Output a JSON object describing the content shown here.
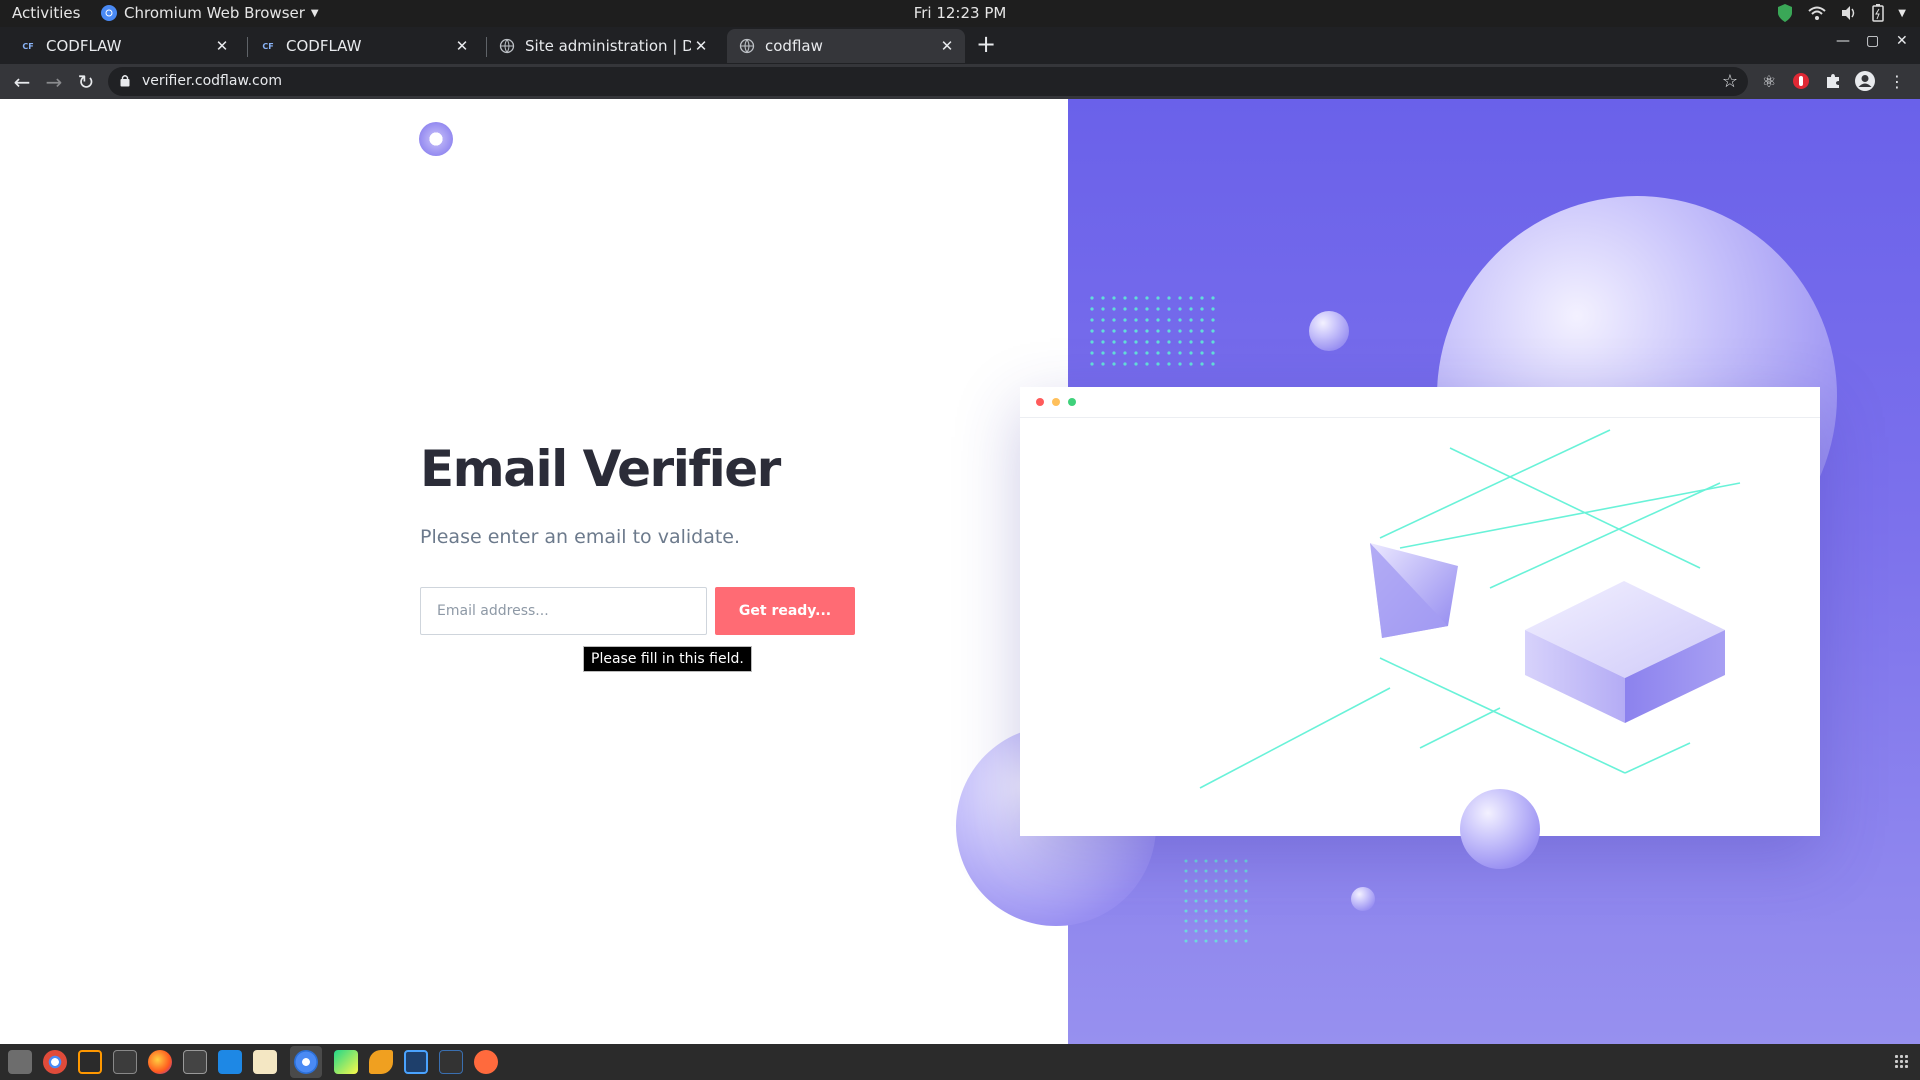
{
  "system": {
    "activities": "Activities",
    "app_name": "Chromium Web Browser",
    "clock": "Fri 12:23 PM"
  },
  "tabs": [
    {
      "title": "CODFLAW",
      "favicon": "CF"
    },
    {
      "title": "CODFLAW",
      "favicon": "CF"
    },
    {
      "title": "Site administration | Djan",
      "favicon": "globe-icon"
    },
    {
      "title": "codflaw",
      "favicon": "globe-icon",
      "active": true
    }
  ],
  "browser": {
    "url": "verifier.codflaw.com"
  },
  "page": {
    "title": "Email Verifier",
    "subtitle": "Please enter an email to validate.",
    "email_placeholder": "Email address...",
    "submit_label": "Get ready...",
    "validation_tooltip": "Please fill in this field."
  },
  "colors": {
    "accent_button": "#ff6b74",
    "panel_top": "#6a61ea",
    "panel_bottom": "#9790ef",
    "heading": "#2b2c38",
    "line_accent": "#4ff0d2"
  }
}
